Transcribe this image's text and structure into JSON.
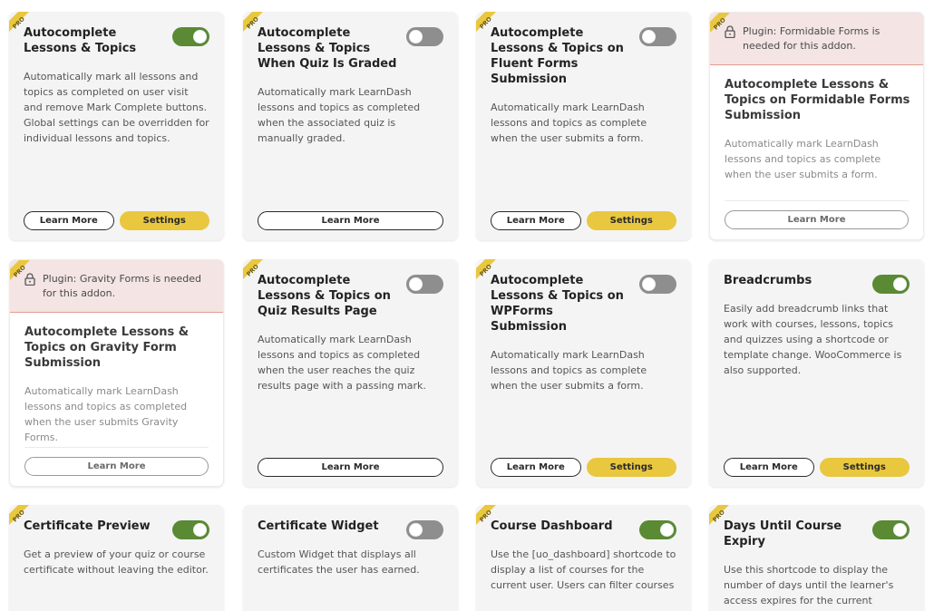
{
  "brand": {
    "pro_color": "#e9c73f",
    "toggle_on_color": "#5a8a34",
    "toggle_off_color": "#8e8e8e",
    "settings_color": "#e9c73f",
    "locked_banner_color": "#f4e4e4"
  },
  "buttons": {
    "learn_more": "Learn More",
    "settings": "Settings"
  },
  "pro_label": "PRO",
  "cards": [
    {
      "title": "Autocomplete Lessons & Topics",
      "pro": true,
      "toggle": "on",
      "locked": false,
      "desc": "Automatically mark all lessons and topics as completed on user visit and remove Mark Complete buttons. Global settings can be overridden for individual lessons and topics.",
      "settings": true
    },
    {
      "title": "Autocomplete Lessons & Topics When Quiz Is Graded",
      "pro": true,
      "toggle": "off",
      "locked": false,
      "desc": "Automatically mark LearnDash lessons and topics as completed when the associated quiz is manually graded.",
      "settings": false
    },
    {
      "title": "Autocomplete Lessons & Topics on Fluent Forms Submission",
      "pro": true,
      "toggle": "off",
      "locked": false,
      "desc": "Automatically mark LearnDash lessons and topics as complete when the user submits a form.",
      "settings": true
    },
    {
      "title": "Autocomplete Lessons & Topics on Formidable Forms Submission",
      "pro": true,
      "toggle": null,
      "locked": true,
      "lock_text": "Plugin: Formidable Forms is needed for this addon.",
      "desc": "Automatically mark LearnDash lessons and topics as complete when the user submits a form.",
      "settings": false
    },
    {
      "title": "Autocomplete Lessons & Topics on Gravity Form Submission",
      "pro": true,
      "toggle": null,
      "locked": true,
      "lock_text": "Plugin: Gravity Forms is needed for this addon.",
      "desc": "Automatically mark LearnDash lessons and topics as completed when the user submits Gravity Forms.",
      "settings": false
    },
    {
      "title": "Autocomplete Lessons & Topics on Quiz Results Page",
      "pro": true,
      "toggle": "off",
      "locked": false,
      "desc": "Automatically mark LearnDash lessons and topics as completed when the user reaches the quiz results page with a passing mark.",
      "settings": false
    },
    {
      "title": "Autocomplete Lessons & Topics on WPForms Submission",
      "pro": true,
      "toggle": "off",
      "locked": false,
      "desc": "Automatically mark LearnDash lessons and topics as complete when the user submits a form.",
      "settings": true
    },
    {
      "title": "Breadcrumbs",
      "pro": false,
      "toggle": "on",
      "locked": false,
      "desc": "Easily add breadcrumb links that work with courses, lessons, topics and quizzes using a shortcode or template change. WooCommerce is also supported.",
      "settings": true
    },
    {
      "title": "Certificate Preview",
      "pro": true,
      "toggle": "on",
      "locked": false,
      "desc": "Get a preview of your quiz or course certificate without leaving the editor.",
      "settings": false
    },
    {
      "title": "Certificate Widget",
      "pro": false,
      "toggle": "off",
      "locked": false,
      "desc": "Custom Widget that displays all certificates the user has earned.",
      "settings": false
    },
    {
      "title": "Course Dashboard",
      "pro": true,
      "toggle": "on",
      "locked": false,
      "desc": "Use the [uo_dashboard] shortcode to display a list of courses for the current user. Users can filter courses",
      "settings": false
    },
    {
      "title": "Days Until Course Expiry",
      "pro": true,
      "toggle": "on",
      "locked": false,
      "desc": "Use this shortcode to display the number of days until the learner's access expires for the current",
      "settings": false
    }
  ]
}
